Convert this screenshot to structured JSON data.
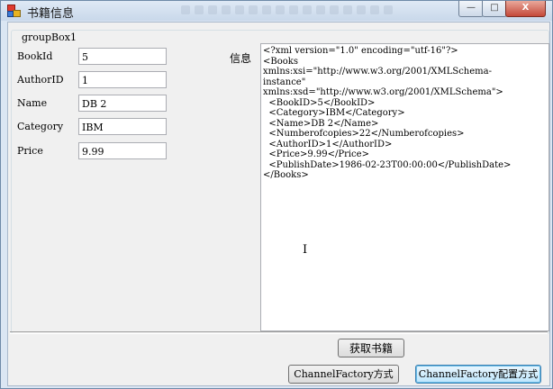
{
  "window": {
    "title": "书籍信息",
    "controls": {
      "minimize": "—",
      "maximize": "□",
      "close": "X"
    }
  },
  "groupbox": {
    "caption": "groupBox1"
  },
  "form": {
    "fields": [
      {
        "label": "BookId",
        "value": "5"
      },
      {
        "label": "AuthorID",
        "value": "1"
      },
      {
        "label": "Name",
        "value": "DB 2"
      },
      {
        "label": "Category",
        "value": "IBM"
      },
      {
        "label": "Price",
        "value": "9.99"
      }
    ]
  },
  "info": {
    "label": "信息",
    "xml_lines": [
      "<?xml version=\"1.0\" encoding=\"utf-16\"?>",
      "<Books",
      "xmlns:xsi=\"http://www.w3.org/2001/XMLSchema-",
      "instance\"",
      "xmlns:xsd=\"http://www.w3.org/2001/XMLSchema\">",
      "  <BookID>5</BookID>",
      "  <Category>IBM</Category>",
      "  <Name>DB 2</Name>",
      "  <Numberofcopies>22</Numberofcopies>",
      "  <AuthorID>1</AuthorID>",
      "  <Price>9.99</Price>",
      "  <PublishDate>1986-02-23T00:00:00</PublishDate>",
      "</Books>"
    ]
  },
  "buttons": {
    "get_books": "获取书籍",
    "channel_factory": "ChannelFactory方式",
    "channel_factory_config": "ChannelFactory配置方式"
  },
  "cursor_glyph": "I"
}
